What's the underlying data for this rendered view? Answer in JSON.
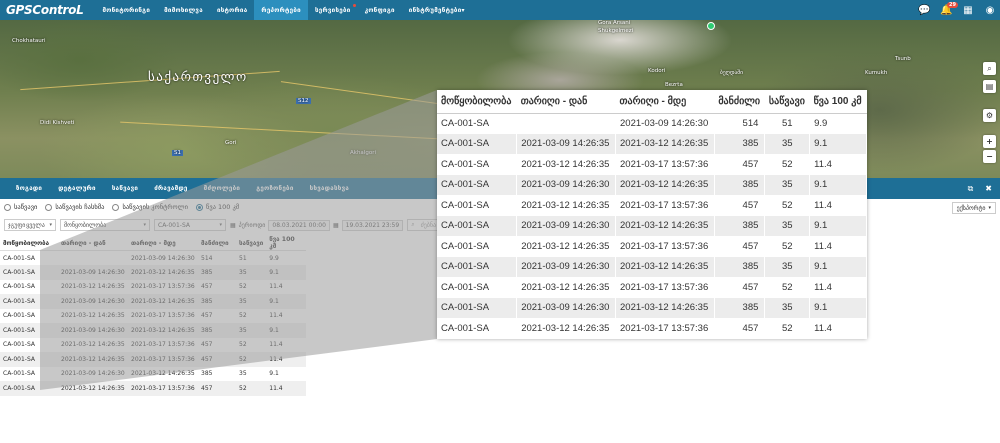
{
  "app": {
    "logo": "GPSControL"
  },
  "nav": [
    {
      "label": "მონიტორინგი",
      "active": false,
      "dot": false,
      "caret": false
    },
    {
      "label": "მიმოხილვა",
      "active": false,
      "dot": false,
      "caret": false
    },
    {
      "label": "ისტორია",
      "active": false,
      "dot": false,
      "caret": false
    },
    {
      "label": "რეპორტები",
      "active": true,
      "dot": false,
      "caret": false
    },
    {
      "label": "სერვისები",
      "active": false,
      "dot": true,
      "caret": false
    },
    {
      "label": "კონფიგი",
      "active": false,
      "dot": false,
      "caret": false
    },
    {
      "label": "ინსტრუმენტები",
      "active": false,
      "dot": false,
      "caret": true
    }
  ],
  "topbar_right": {
    "chat_icon": "chat-icon",
    "bell_icon": "bell-icon",
    "bell_badge": "29",
    "apps_icon": "grid-icon",
    "user_icon": "user-icon"
  },
  "map": {
    "country_label": "საქართველო",
    "places": [
      "Gora Arsani",
      "Shukgelmezi",
      "Kodori",
      "Bezrta",
      "ბეღდაში",
      "Tsunb",
      "Kumukh",
      "Chokhatauri",
      "Akhalgori",
      "Gori",
      "Didi Kishveti"
    ],
    "road_numbers": [
      "S12",
      "S1"
    ],
    "controls": [
      "search-icon",
      "book-icon",
      "gear-icon",
      "zoom-in-icon",
      "zoom-out-icon"
    ]
  },
  "subnav": [
    "ზოგადი",
    "დეტალური",
    "საწვავი",
    "ძრავამდე",
    "მძღოლები",
    "გეოზონები",
    "სხვადასხვა"
  ],
  "subnav_right": {
    "window_icon": "window-icon",
    "close_icon": "close-icon"
  },
  "report_type": {
    "options": [
      "საწვავი",
      "საწვავის ჩასხმა",
      "საწვავის კონტროლი",
      "წვა 100 კმ"
    ],
    "selected": 3
  },
  "filters": {
    "group": "ჯგუფი",
    "group_value": "ყველა",
    "vehicle_label": "მონყობილობა",
    "vehicle_value": "CA-001-SA",
    "period_label": "პერიოდი",
    "date_from": "08.03.2021 00:00",
    "date_to": "19.03.2021 23:59",
    "search_placeholder": "ძებნა",
    "right_select": "ექსპორტი"
  },
  "table": {
    "columns": [
      "მოწყობილობა",
      "თარიღი - დან",
      "თარიღი - მდე",
      "მანძილი",
      "საწვავი",
      "წვა 100 კმ"
    ],
    "rows": [
      [
        "CA-001-SA",
        "",
        "2021-03-09 14:26:30",
        "514",
        "51",
        "9.9"
      ],
      [
        "CA-001-SA",
        "2021-03-09 14:26:30",
        "2021-03-12 14:26:35",
        "385",
        "35",
        "9.1"
      ],
      [
        "CA-001-SA",
        "2021-03-12 14:26:35",
        "2021-03-17 13:57:36",
        "457",
        "52",
        "11.4"
      ],
      [
        "CA-001-SA",
        "2021-03-09 14:26:30",
        "2021-03-12 14:26:35",
        "385",
        "35",
        "9.1"
      ],
      [
        "CA-001-SA",
        "2021-03-12 14:26:35",
        "2021-03-17 13:57:36",
        "457",
        "52",
        "11.4"
      ],
      [
        "CA-001-SA",
        "2021-03-09 14:26:30",
        "2021-03-12 14:26:35",
        "385",
        "35",
        "9.1"
      ],
      [
        "CA-001-SA",
        "2021-03-12 14:26:35",
        "2021-03-17 13:57:36",
        "457",
        "52",
        "11.4"
      ],
      [
        "CA-001-SA",
        "2021-03-12 14:26:35",
        "2021-03-17 13:57:36",
        "457",
        "52",
        "11.4"
      ],
      [
        "CA-001-SA",
        "2021-03-09 14:26:30",
        "2021-03-12 14:26:35",
        "385",
        "35",
        "9.1"
      ],
      [
        "CA-001-SA",
        "2021-03-12 14:26:35",
        "2021-03-17 13:57:36",
        "457",
        "52",
        "11.4"
      ]
    ]
  },
  "zoom_table": {
    "columns": [
      "მოწყობილობა",
      "თარიღი - დან",
      "თარიღი - მდე",
      "მანძილი",
      "საწვავი",
      "წვა 100 კმ"
    ],
    "rows": [
      [
        "CA-001-SA",
        "",
        "2021-03-09 14:26:30",
        "514",
        "51",
        "9.9"
      ],
      [
        "CA-001-SA",
        "2021-03-09 14:26:35",
        "2021-03-12 14:26:35",
        "385",
        "35",
        "9.1"
      ],
      [
        "CA-001-SA",
        "2021-03-12 14:26:35",
        "2021-03-17 13:57:36",
        "457",
        "52",
        "11.4"
      ],
      [
        "CA-001-SA",
        "2021-03-09 14:26:30",
        "2021-03-12 14:26:35",
        "385",
        "35",
        "9.1"
      ],
      [
        "CA-001-SA",
        "2021-03-12 14:26:35",
        "2021-03-17 13:57:36",
        "457",
        "52",
        "11.4"
      ],
      [
        "CA-001-SA",
        "2021-03-09 14:26:30",
        "2021-03-12 14:26:35",
        "385",
        "35",
        "9.1"
      ],
      [
        "CA-001-SA",
        "2021-03-12 14:26:35",
        "2021-03-17 13:57:36",
        "457",
        "52",
        "11.4"
      ],
      [
        "CA-001-SA",
        "2021-03-09 14:26:30",
        "2021-03-12 14:26:35",
        "385",
        "35",
        "9.1"
      ],
      [
        "CA-001-SA",
        "2021-03-12 14:26:35",
        "2021-03-17 13:57:36",
        "457",
        "52",
        "11.4"
      ],
      [
        "CA-001-SA",
        "2021-03-09 14:26:30",
        "2021-03-12 14:26:35",
        "385",
        "35",
        "9.1"
      ],
      [
        "CA-001-SA",
        "2021-03-12 14:26:35",
        "2021-03-17 13:57:36",
        "457",
        "52",
        "11.4"
      ]
    ]
  },
  "colors": {
    "brand": "#1e6f96",
    "active_tab": "#2c8fbe",
    "badge": "#e74c3c",
    "stripe": "#ececec"
  }
}
